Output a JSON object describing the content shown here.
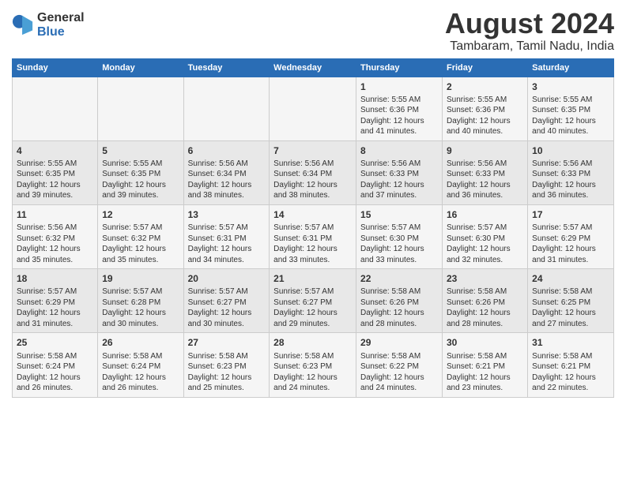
{
  "logo": {
    "general": "General",
    "blue": "Blue"
  },
  "title": "August 2024",
  "location": "Tambaram, Tamil Nadu, India",
  "days_of_week": [
    "Sunday",
    "Monday",
    "Tuesday",
    "Wednesday",
    "Thursday",
    "Friday",
    "Saturday"
  ],
  "weeks": [
    [
      {
        "day": "",
        "info": ""
      },
      {
        "day": "",
        "info": ""
      },
      {
        "day": "",
        "info": ""
      },
      {
        "day": "",
        "info": ""
      },
      {
        "day": "1",
        "info": "Sunrise: 5:55 AM\nSunset: 6:36 PM\nDaylight: 12 hours\nand 41 minutes."
      },
      {
        "day": "2",
        "info": "Sunrise: 5:55 AM\nSunset: 6:36 PM\nDaylight: 12 hours\nand 40 minutes."
      },
      {
        "day": "3",
        "info": "Sunrise: 5:55 AM\nSunset: 6:35 PM\nDaylight: 12 hours\nand 40 minutes."
      }
    ],
    [
      {
        "day": "4",
        "info": "Sunrise: 5:55 AM\nSunset: 6:35 PM\nDaylight: 12 hours\nand 39 minutes."
      },
      {
        "day": "5",
        "info": "Sunrise: 5:55 AM\nSunset: 6:35 PM\nDaylight: 12 hours\nand 39 minutes."
      },
      {
        "day": "6",
        "info": "Sunrise: 5:56 AM\nSunset: 6:34 PM\nDaylight: 12 hours\nand 38 minutes."
      },
      {
        "day": "7",
        "info": "Sunrise: 5:56 AM\nSunset: 6:34 PM\nDaylight: 12 hours\nand 38 minutes."
      },
      {
        "day": "8",
        "info": "Sunrise: 5:56 AM\nSunset: 6:33 PM\nDaylight: 12 hours\nand 37 minutes."
      },
      {
        "day": "9",
        "info": "Sunrise: 5:56 AM\nSunset: 6:33 PM\nDaylight: 12 hours\nand 36 minutes."
      },
      {
        "day": "10",
        "info": "Sunrise: 5:56 AM\nSunset: 6:33 PM\nDaylight: 12 hours\nand 36 minutes."
      }
    ],
    [
      {
        "day": "11",
        "info": "Sunrise: 5:56 AM\nSunset: 6:32 PM\nDaylight: 12 hours\nand 35 minutes."
      },
      {
        "day": "12",
        "info": "Sunrise: 5:57 AM\nSunset: 6:32 PM\nDaylight: 12 hours\nand 35 minutes."
      },
      {
        "day": "13",
        "info": "Sunrise: 5:57 AM\nSunset: 6:31 PM\nDaylight: 12 hours\nand 34 minutes."
      },
      {
        "day": "14",
        "info": "Sunrise: 5:57 AM\nSunset: 6:31 PM\nDaylight: 12 hours\nand 33 minutes."
      },
      {
        "day": "15",
        "info": "Sunrise: 5:57 AM\nSunset: 6:30 PM\nDaylight: 12 hours\nand 33 minutes."
      },
      {
        "day": "16",
        "info": "Sunrise: 5:57 AM\nSunset: 6:30 PM\nDaylight: 12 hours\nand 32 minutes."
      },
      {
        "day": "17",
        "info": "Sunrise: 5:57 AM\nSunset: 6:29 PM\nDaylight: 12 hours\nand 31 minutes."
      }
    ],
    [
      {
        "day": "18",
        "info": "Sunrise: 5:57 AM\nSunset: 6:29 PM\nDaylight: 12 hours\nand 31 minutes."
      },
      {
        "day": "19",
        "info": "Sunrise: 5:57 AM\nSunset: 6:28 PM\nDaylight: 12 hours\nand 30 minutes."
      },
      {
        "day": "20",
        "info": "Sunrise: 5:57 AM\nSunset: 6:27 PM\nDaylight: 12 hours\nand 30 minutes."
      },
      {
        "day": "21",
        "info": "Sunrise: 5:57 AM\nSunset: 6:27 PM\nDaylight: 12 hours\nand 29 minutes."
      },
      {
        "day": "22",
        "info": "Sunrise: 5:58 AM\nSunset: 6:26 PM\nDaylight: 12 hours\nand 28 minutes."
      },
      {
        "day": "23",
        "info": "Sunrise: 5:58 AM\nSunset: 6:26 PM\nDaylight: 12 hours\nand 28 minutes."
      },
      {
        "day": "24",
        "info": "Sunrise: 5:58 AM\nSunset: 6:25 PM\nDaylight: 12 hours\nand 27 minutes."
      }
    ],
    [
      {
        "day": "25",
        "info": "Sunrise: 5:58 AM\nSunset: 6:24 PM\nDaylight: 12 hours\nand 26 minutes."
      },
      {
        "day": "26",
        "info": "Sunrise: 5:58 AM\nSunset: 6:24 PM\nDaylight: 12 hours\nand 26 minutes."
      },
      {
        "day": "27",
        "info": "Sunrise: 5:58 AM\nSunset: 6:23 PM\nDaylight: 12 hours\nand 25 minutes."
      },
      {
        "day": "28",
        "info": "Sunrise: 5:58 AM\nSunset: 6:23 PM\nDaylight: 12 hours\nand 24 minutes."
      },
      {
        "day": "29",
        "info": "Sunrise: 5:58 AM\nSunset: 6:22 PM\nDaylight: 12 hours\nand 24 minutes."
      },
      {
        "day": "30",
        "info": "Sunrise: 5:58 AM\nSunset: 6:21 PM\nDaylight: 12 hours\nand 23 minutes."
      },
      {
        "day": "31",
        "info": "Sunrise: 5:58 AM\nSunset: 6:21 PM\nDaylight: 12 hours\nand 22 minutes."
      }
    ]
  ]
}
